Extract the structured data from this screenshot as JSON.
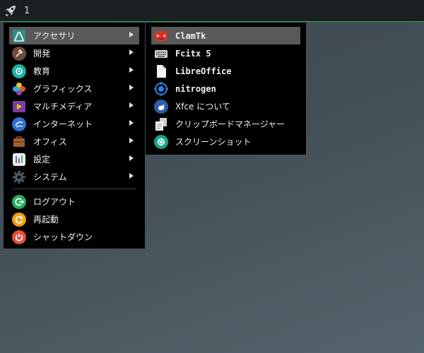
{
  "panel": {
    "workspace": "1"
  },
  "menu": {
    "items": [
      {
        "label": "アクセサリ"
      },
      {
        "label": "開発"
      },
      {
        "label": "教育"
      },
      {
        "label": "グラフィックス"
      },
      {
        "label": "マルチメディア"
      },
      {
        "label": "インターネット"
      },
      {
        "label": "オフィス"
      },
      {
        "label": "設定"
      },
      {
        "label": "システム"
      }
    ],
    "actions": [
      {
        "label": "ログアウト"
      },
      {
        "label": "再起動"
      },
      {
        "label": "シャットダウン"
      }
    ]
  },
  "submenu": {
    "items": [
      {
        "label": "ClamTk"
      },
      {
        "label": "Fcitx 5"
      },
      {
        "label": "LibreOffice"
      },
      {
        "label": "nitrogen"
      },
      {
        "label": "Xfce について"
      },
      {
        "label": "クリップボードマネージャー"
      },
      {
        "label": "スクリーンショット"
      }
    ]
  },
  "colors": {
    "panel_bg": "#1b1f22",
    "panel_accent": "#2ea84d",
    "menu_bg": "#000000",
    "highlight": "#595959"
  },
  "icons": [
    "rocket-icon",
    "accessories-icon",
    "hammer-icon",
    "education-icon",
    "graphics-icon",
    "multimedia-icon",
    "internet-icon",
    "office-icon",
    "settings-icon",
    "system-gear-icon",
    "logout-icon",
    "restart-icon",
    "shutdown-icon",
    "clamtk-icon",
    "keyboard-icon",
    "document-icon",
    "nitrogen-icon",
    "xfce-icon",
    "clipboard-icon",
    "screenshot-icon"
  ]
}
